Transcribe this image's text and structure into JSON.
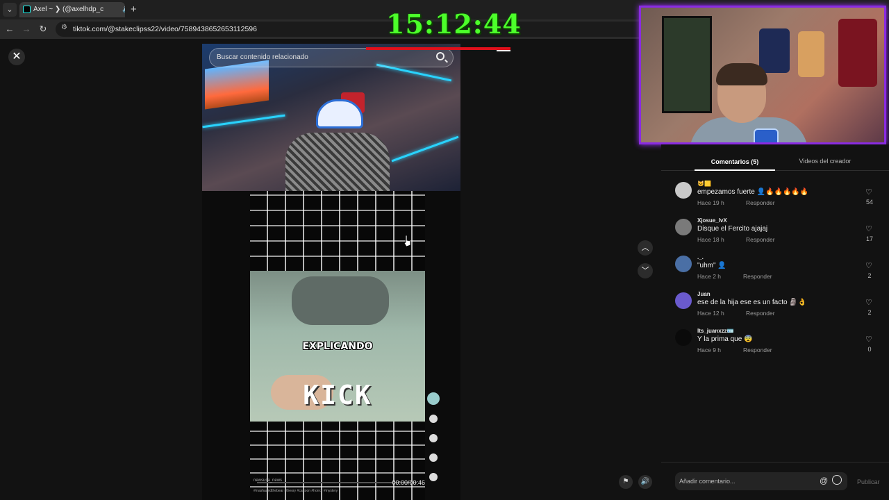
{
  "browser": {
    "tab_title": "Axel ~ ❯ (@axelhdp_c",
    "tab_audio_icon": "speaker-icon",
    "tab_close_icon": "close-icon",
    "new_tab": "+",
    "url": "tiktok.com/@stakeclipss22/video/7589438652653112596"
  },
  "overlay": {
    "clock": "15:12:44"
  },
  "video": {
    "search_placeholder": "Buscar contenido relacionado",
    "caption_small": "EXPLICANDO",
    "caption_big": "KICK",
    "time": "00:00/00:46",
    "user_tag": "newsusa_news",
    "hashtags": "#mashaandthebear #theory #cartoon #horror #mystery"
  },
  "panel": {
    "tab_comments": "Comentarios (5)",
    "tab_videos": "Videos del creador",
    "reply_label": "Responder",
    "comments": [
      {
        "user": "😺🟨",
        "text": "empezamos fuerte 👤🔥🔥🔥🔥🔥",
        "time": "Hace 19 h",
        "likes": "54",
        "avatar_color": "#c9c9c9"
      },
      {
        "user": "Xjosue_lvX",
        "text": "Disque el Fercito ajajaj",
        "time": "Hace 18 h",
        "likes": "17",
        "avatar_color": "#7a7a7a"
      },
      {
        "user": "._.",
        "text": "\"uhm\" 👤",
        "time": "Hace 2 h",
        "likes": "2",
        "avatar_color": "#4a6fa5"
      },
      {
        "user": "Juan",
        "text": "ese de la hija ese es un facto 🗿👌",
        "time": "Hace 12 h",
        "likes": "2",
        "avatar_color": "#6a5acd"
      },
      {
        "user": "Its_juanxzz🪪",
        "text": "Y la prima que 😨",
        "time": "Hace 9 h",
        "likes": "0",
        "avatar_color": "#0a0a0a"
      }
    ],
    "composer_placeholder": "Añadir comentario...",
    "mention_symbol": "@",
    "post_label": "Publicar"
  },
  "colors": {
    "clock": "#4cff2a",
    "cam_border": "#8a2be2",
    "progress_red": "#e0101b"
  }
}
